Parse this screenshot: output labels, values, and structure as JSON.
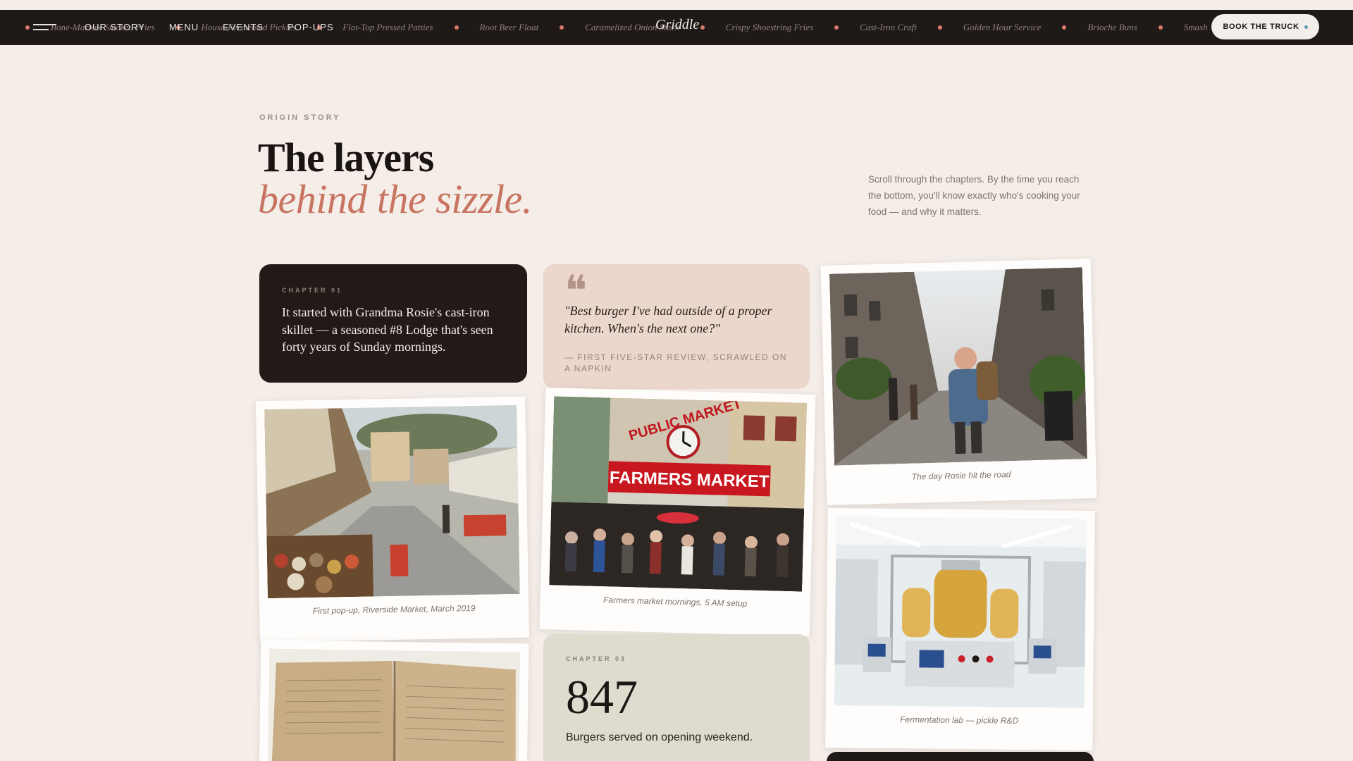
{
  "nav": {
    "ticker": [
      "Bone-Marrow Smoked Fries",
      "House-Fermented Pickles",
      "Flat-Top Pressed Patties",
      "Root Beer Float",
      "Caramelized Onion Stack",
      "Crispy Shoestring Fries",
      "Cast-Iron Craft",
      "Golden Hour Service",
      "Brioche Buns",
      "Smash"
    ],
    "links": [
      "OUR STORY",
      "MENU",
      "EVENTS",
      "POP-UPS"
    ],
    "brand": "Griddle",
    "cta_label": "BOOK THE TRUCK",
    "colors": {
      "bar": "#1f1917",
      "accent_dot": "#d97a6a",
      "cta_dot": "#5a9bb3"
    }
  },
  "hero": {
    "eyebrow": "ORIGIN STORY",
    "title_line1": "The layers",
    "title_line2": "behind the sizzle.",
    "intro": "Scroll through the chapters. By the time you reach the bottom, you'll know exactly who's cooking your food — and why it matters.",
    "accent": "#c87461"
  },
  "chapter1": {
    "label": "CHAPTER 01",
    "text": "It started with Grandma Rosie's cast-iron skillet — a seasoned #8 Lodge that's seen forty years of Sunday mornings."
  },
  "quote": {
    "text": "\"Best burger I've had outside of a proper kitchen. When's the next one?\"",
    "attribution": "— FIRST FIVE-STAR REVIEW, SCRAWLED ON A NAPKIN"
  },
  "photos": {
    "riverside": {
      "caption": "First pop-up, Riverside Market, March 2019"
    },
    "farmers": {
      "caption": "Farmers market mornings, 5 AM setup",
      "sign_top": "PUBLIC MARKET",
      "sign_main": "FARMERS MARKET"
    },
    "road": {
      "caption": "The day Rosie hit the road"
    },
    "lab": {
      "caption": "Fermentation lab — pickle R&D"
    }
  },
  "chapter3": {
    "label": "CHAPTER 03",
    "number": "847",
    "caption": "Burgers served on opening weekend."
  }
}
